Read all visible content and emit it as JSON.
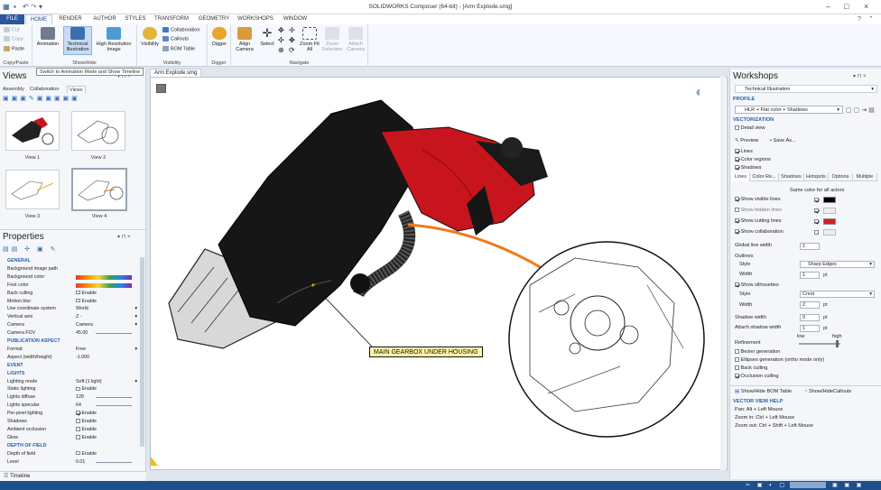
{
  "window": {
    "title": "SOLIDWORKS Composer (64-bit) - [Arm Explode.smg]"
  },
  "ribbon": {
    "tabs": [
      "FILE",
      "HOME",
      "RENDER",
      "AUTHOR",
      "STYLES",
      "TRANSFORM",
      "GEOMETRY",
      "WORKSHOPS",
      "WINDOW"
    ],
    "clipboard": {
      "cut": "Cut",
      "copy": "Copy",
      "paste": "Paste",
      "group": "Copy/Paste"
    },
    "showhide": {
      "animation": "Animation",
      "technical": "Technical Illustration",
      "highres": "High Resolution Image",
      "group": "Show/Hide"
    },
    "visibility": {
      "visibility": "Visibility",
      "collaboration": "Collaboration",
      "callouts": "Callouts",
      "bom": "BOM Table",
      "group": "Visibility"
    },
    "digger": {
      "digger": "Digger",
      "group": "Digger"
    },
    "navigate": {
      "align": "Align Camera",
      "select": "Select",
      "zoomfit": "Zoom Fit All",
      "zoomsel": "Zoom Selection",
      "attach": "Attach Camera",
      "group": "Navigate"
    }
  },
  "tooltip": "Switch to Animation Mode and Show Timeline",
  "views_panel": {
    "title": "Views",
    "tabs": [
      "Assembly",
      "Collaboration",
      "Views"
    ],
    "thumbs": [
      "View 1",
      "View 2",
      "View 3",
      "View 4"
    ]
  },
  "properties_panel": {
    "title": "Properties",
    "rows": [
      {
        "label": "GENERAL",
        "value": "",
        "type": "section"
      },
      {
        "label": "Background image path",
        "value": "",
        "type": "text"
      },
      {
        "label": "Background color",
        "value": "",
        "type": "gradient"
      },
      {
        "label": "Foot color",
        "value": "",
        "type": "gradient"
      },
      {
        "label": "Back culling",
        "value": "Enable",
        "type": "check",
        "checked": false
      },
      {
        "label": "Motion blur",
        "value": "Enable",
        "type": "check",
        "checked": false
      },
      {
        "label": "Use coordinate system",
        "value": "World",
        "type": "combo"
      },
      {
        "label": "Vertical axis",
        "value": "Z -",
        "type": "combo"
      },
      {
        "label": "Camera",
        "value": "Camera",
        "type": "combo"
      },
      {
        "label": "Camera FOV",
        "value": "45.00",
        "type": "slider"
      },
      {
        "label": "PUBLICATION ASPECT",
        "value": "",
        "type": "section"
      },
      {
        "label": "Format",
        "value": "Free",
        "type": "combo"
      },
      {
        "label": "Aspect (width/height)",
        "value": "-1.000",
        "type": "text"
      },
      {
        "label": "EVENT",
        "value": "",
        "type": "section"
      },
      {
        "label": "LIGHTS",
        "value": "",
        "type": "section"
      },
      {
        "label": "Lighting mode",
        "value": "Soft (1 light)",
        "type": "combo"
      },
      {
        "label": "Static lighting",
        "value": "Enable",
        "type": "check",
        "checked": false
      },
      {
        "label": "Lights diffuse",
        "value": "128",
        "type": "slider"
      },
      {
        "label": "Lights specular",
        "value": "64",
        "type": "slider"
      },
      {
        "label": "Per-pixel lighting",
        "value": "Enable",
        "type": "check",
        "checked": true
      },
      {
        "label": "Shadows",
        "value": "Enable",
        "type": "check",
        "checked": false
      },
      {
        "label": "Ambient occlusion",
        "value": "Enable",
        "type": "check",
        "checked": false
      },
      {
        "label": "Glow",
        "value": "Enable",
        "type": "check",
        "checked": false
      },
      {
        "label": "DEPTH OF FIELD",
        "value": "",
        "type": "section"
      },
      {
        "label": "Depth of field",
        "value": "Enable",
        "type": "check",
        "checked": false
      },
      {
        "label": "Level",
        "value": "0.01",
        "type": "slider"
      }
    ]
  },
  "timeline": "Timeline",
  "document_tab": "Arm Explode.smg",
  "viewport": {
    "callout": "MAIN GEARBOX UNDER HOUSING"
  },
  "workshops": {
    "title": "Workshops",
    "name": "Technical Illustration",
    "profile_label": "PROFILE",
    "profile_value": "HLR + Flat color + Shadows",
    "vectorization_label": "VECTORIZATION",
    "detail_view": "Detail view",
    "preview": "Preview",
    "save_as": "Save As...",
    "lines": "Lines",
    "color_regions": "Color regions",
    "shadows": "Shadows",
    "tabs": [
      "Lines",
      "Color Re...",
      "Shadows",
      "Hotspots",
      "Options",
      "Multiple"
    ],
    "same_color": "Same color for all actors",
    "show_visible": "Show visible lines",
    "show_hidden": "Show hidden lines",
    "show_cutting": "Show cutting lines",
    "show_collab": "Show collaboration",
    "global_width_label": "Global line width",
    "global_width": "1",
    "outlines": "Outlines",
    "style_label": "Style",
    "outline_style": "Sharp Edges",
    "width_label": "Width",
    "outline_width": "1",
    "pt": "pt",
    "show_silhouettes": "Show silhouettes",
    "silhouette_style": "Crest",
    "silhouette_width": "2",
    "shadow_width_label": "Shadow width",
    "shadow_width": "0",
    "attach_shadow_label": "Attach shadow width",
    "attach_shadow": "1",
    "refinement": "Refinement",
    "low": "low",
    "high": "high",
    "bezier": "Bezier generation",
    "ellipses": "Ellipses generation (ortho mode only)",
    "back_culling": "Back culling",
    "occlusion": "Occlusion culling",
    "show_bom": "Show/Hide BOM Table",
    "show_callouts": "Show/HideCallouts",
    "help_label": "VECTOR VIEW HELP",
    "help_pan": "Pan: Alt + Left Mouse",
    "help_zoom": "Zoom in: Ctrl + Left Mouse",
    "help_zoomout": "Zoom out: Ctrl + Shift + Left Mouse"
  },
  "colors": {
    "accent": "#2b579a",
    "section": "#2b5fa8",
    "housing": "#c8141c",
    "callout_line": "#f07a1a",
    "callout_bg": "#fff4a8"
  }
}
